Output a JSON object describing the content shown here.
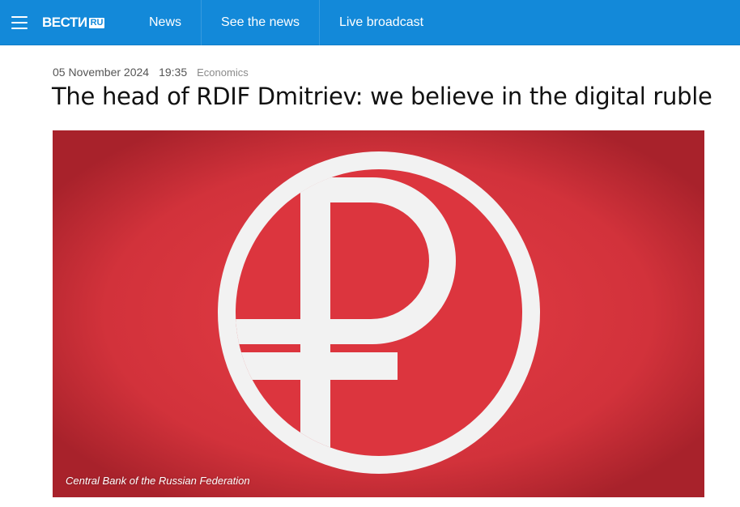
{
  "header": {
    "logo_text": "ВЕСТИ",
    "logo_badge": "RU",
    "brand_color": "#1389d9",
    "nav": [
      {
        "label": "News"
      },
      {
        "label": "See the news"
      },
      {
        "label": "Live broadcast"
      }
    ]
  },
  "article": {
    "date": "05 November 2024",
    "time": "19:35",
    "category": "Economics",
    "title": "The head of RDIF Dmitriev: we believe in the digital ruble",
    "image": {
      "icon": "ruble-sign-icon",
      "background_color": "#d9323c",
      "caption": "Central Bank of the Russian Federation"
    }
  }
}
